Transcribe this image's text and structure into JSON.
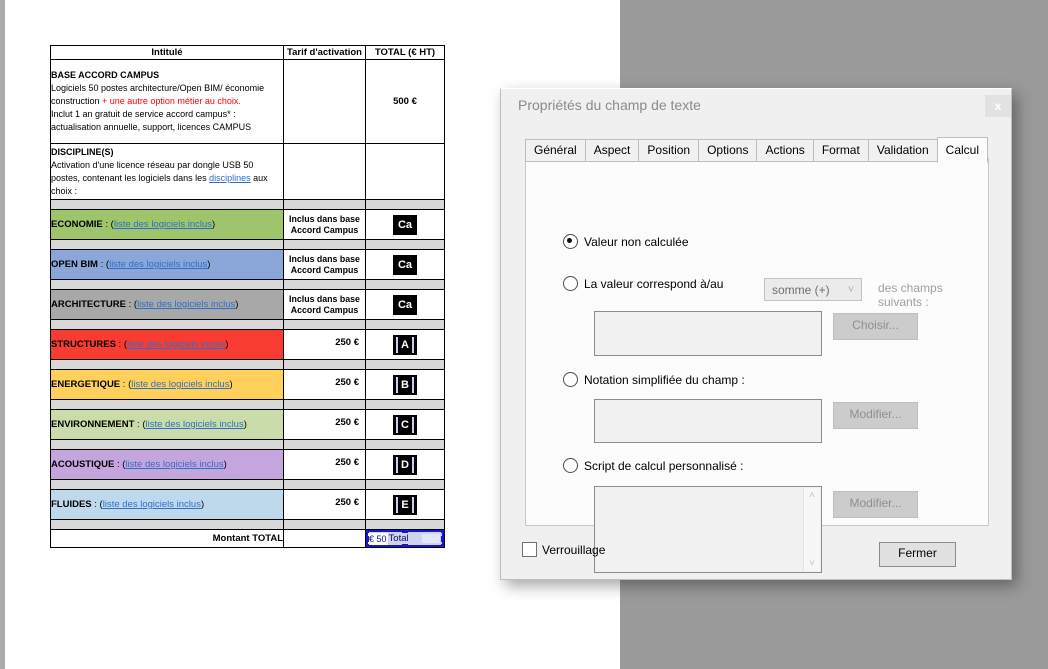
{
  "table": {
    "headers": [
      "Intitulé",
      "Tarif d'activation",
      "TOTAL (€ HT)"
    ],
    "sep": " : (",
    "close_paren": ")",
    "base": {
      "title": "BASE ACCORD CAMPUS",
      "line1": "Logiciels 50 postes architecture/Open BIM/ économie",
      "line2_black": "construction ",
      "line2_red": "+ une autre option métier au choix.",
      "line3": "Inclut 1 an gratuit de service accord campus* :",
      "line4": "actualisation annuelle, support, licences CAMPUS",
      "total": "500 €"
    },
    "disc": {
      "title": "DISCIPLINE(S)",
      "line1": "Activation d'une licence réseau par dongle USB 50",
      "line2_pre": "postes, contenant les logiciels dans les ",
      "line2_link": "disciplines",
      "line2_post": " aux",
      "line3": "choix :"
    },
    "rows": [
      {
        "name": "ECONOMIE",
        "link": "liste des logiciels inclus",
        "tarif1": "Inclus dans base",
        "tarif2": "Accord Campus",
        "badge": "Ca",
        "color": "#9EC46C"
      },
      {
        "name": "OPEN BIM",
        "link": "liste des logiciels inclus",
        "tarif1": "Inclus dans base",
        "tarif2": "Accord Campus",
        "badge": "Ca",
        "color": "#8BA7D9"
      },
      {
        "name": "ARCHITECTURE",
        "link": "liste des logiciels inclus",
        "tarif1": "Inclus dans base",
        "tarif2": "Accord Campus",
        "badge": "Ca",
        "color": "#A8A8A8"
      },
      {
        "name": "STRUCTURES",
        "link": "liste des logiciels inclus",
        "tarif1": "250 €",
        "tarif2": "",
        "badge": "A",
        "color": "#F93C32"
      },
      {
        "name": "ENERGETIQUE",
        "link": "liste des logiciels inclus",
        "tarif1": "250 €",
        "tarif2": "",
        "badge": "B",
        "color": "#FFD15C"
      },
      {
        "name": "ENVIRONNEMENT",
        "link": "liste des logiciels inclus",
        "tarif1": "250 €",
        "tarif2": "",
        "badge": "C",
        "color": "#C9DCA9"
      },
      {
        "name": "ACOUSTIQUE",
        "link": "liste des logiciels inclus",
        "tarif1": "250 €",
        "tarif2": "",
        "badge": "D",
        "color": "#C5A5DE"
      },
      {
        "name": "FLUIDES",
        "link": "liste des logiciels inclus",
        "tarif1": "250 €",
        "tarif2": "",
        "badge": "E",
        "color": "#BFD9EC"
      }
    ],
    "total_label": "Montant TOTAL",
    "field_value": "€ 50",
    "field_name": "Total"
  },
  "dialog": {
    "title": "Propriétés du champ de texte",
    "close_icon": "x",
    "tabs": [
      "Général",
      "Aspect",
      "Position",
      "Options",
      "Actions",
      "Format",
      "Validation",
      "Calcul"
    ],
    "active_tab": "Calcul",
    "calc": {
      "radio_none": "Valeur non calculée",
      "radio_sum": "La valeur correspond à/au",
      "operator": "somme (+)",
      "dropdown_arrow": "˅",
      "sum_suffix": "des champs suivants :",
      "choose_button": "Choisir...",
      "radio_simple": "Notation simplifiée du champ :",
      "modify_button1": "Modifier...",
      "radio_script": "Script de calcul personnalisé :",
      "modify_button2": "Modifier...",
      "scroll_up": "˄",
      "scroll_down": "˅"
    },
    "lock_label": "Verrouillage",
    "close_button": "Fermer"
  },
  "colors": {
    "selection_blue": "#1414E0",
    "link_blue": "#2E6FC9",
    "alert_red": "#FF0000",
    "dialog_bg": "#F0F0F0",
    "canvas_gray": "#9A9A9A",
    "spacer_gray": "#D8D8D8"
  }
}
